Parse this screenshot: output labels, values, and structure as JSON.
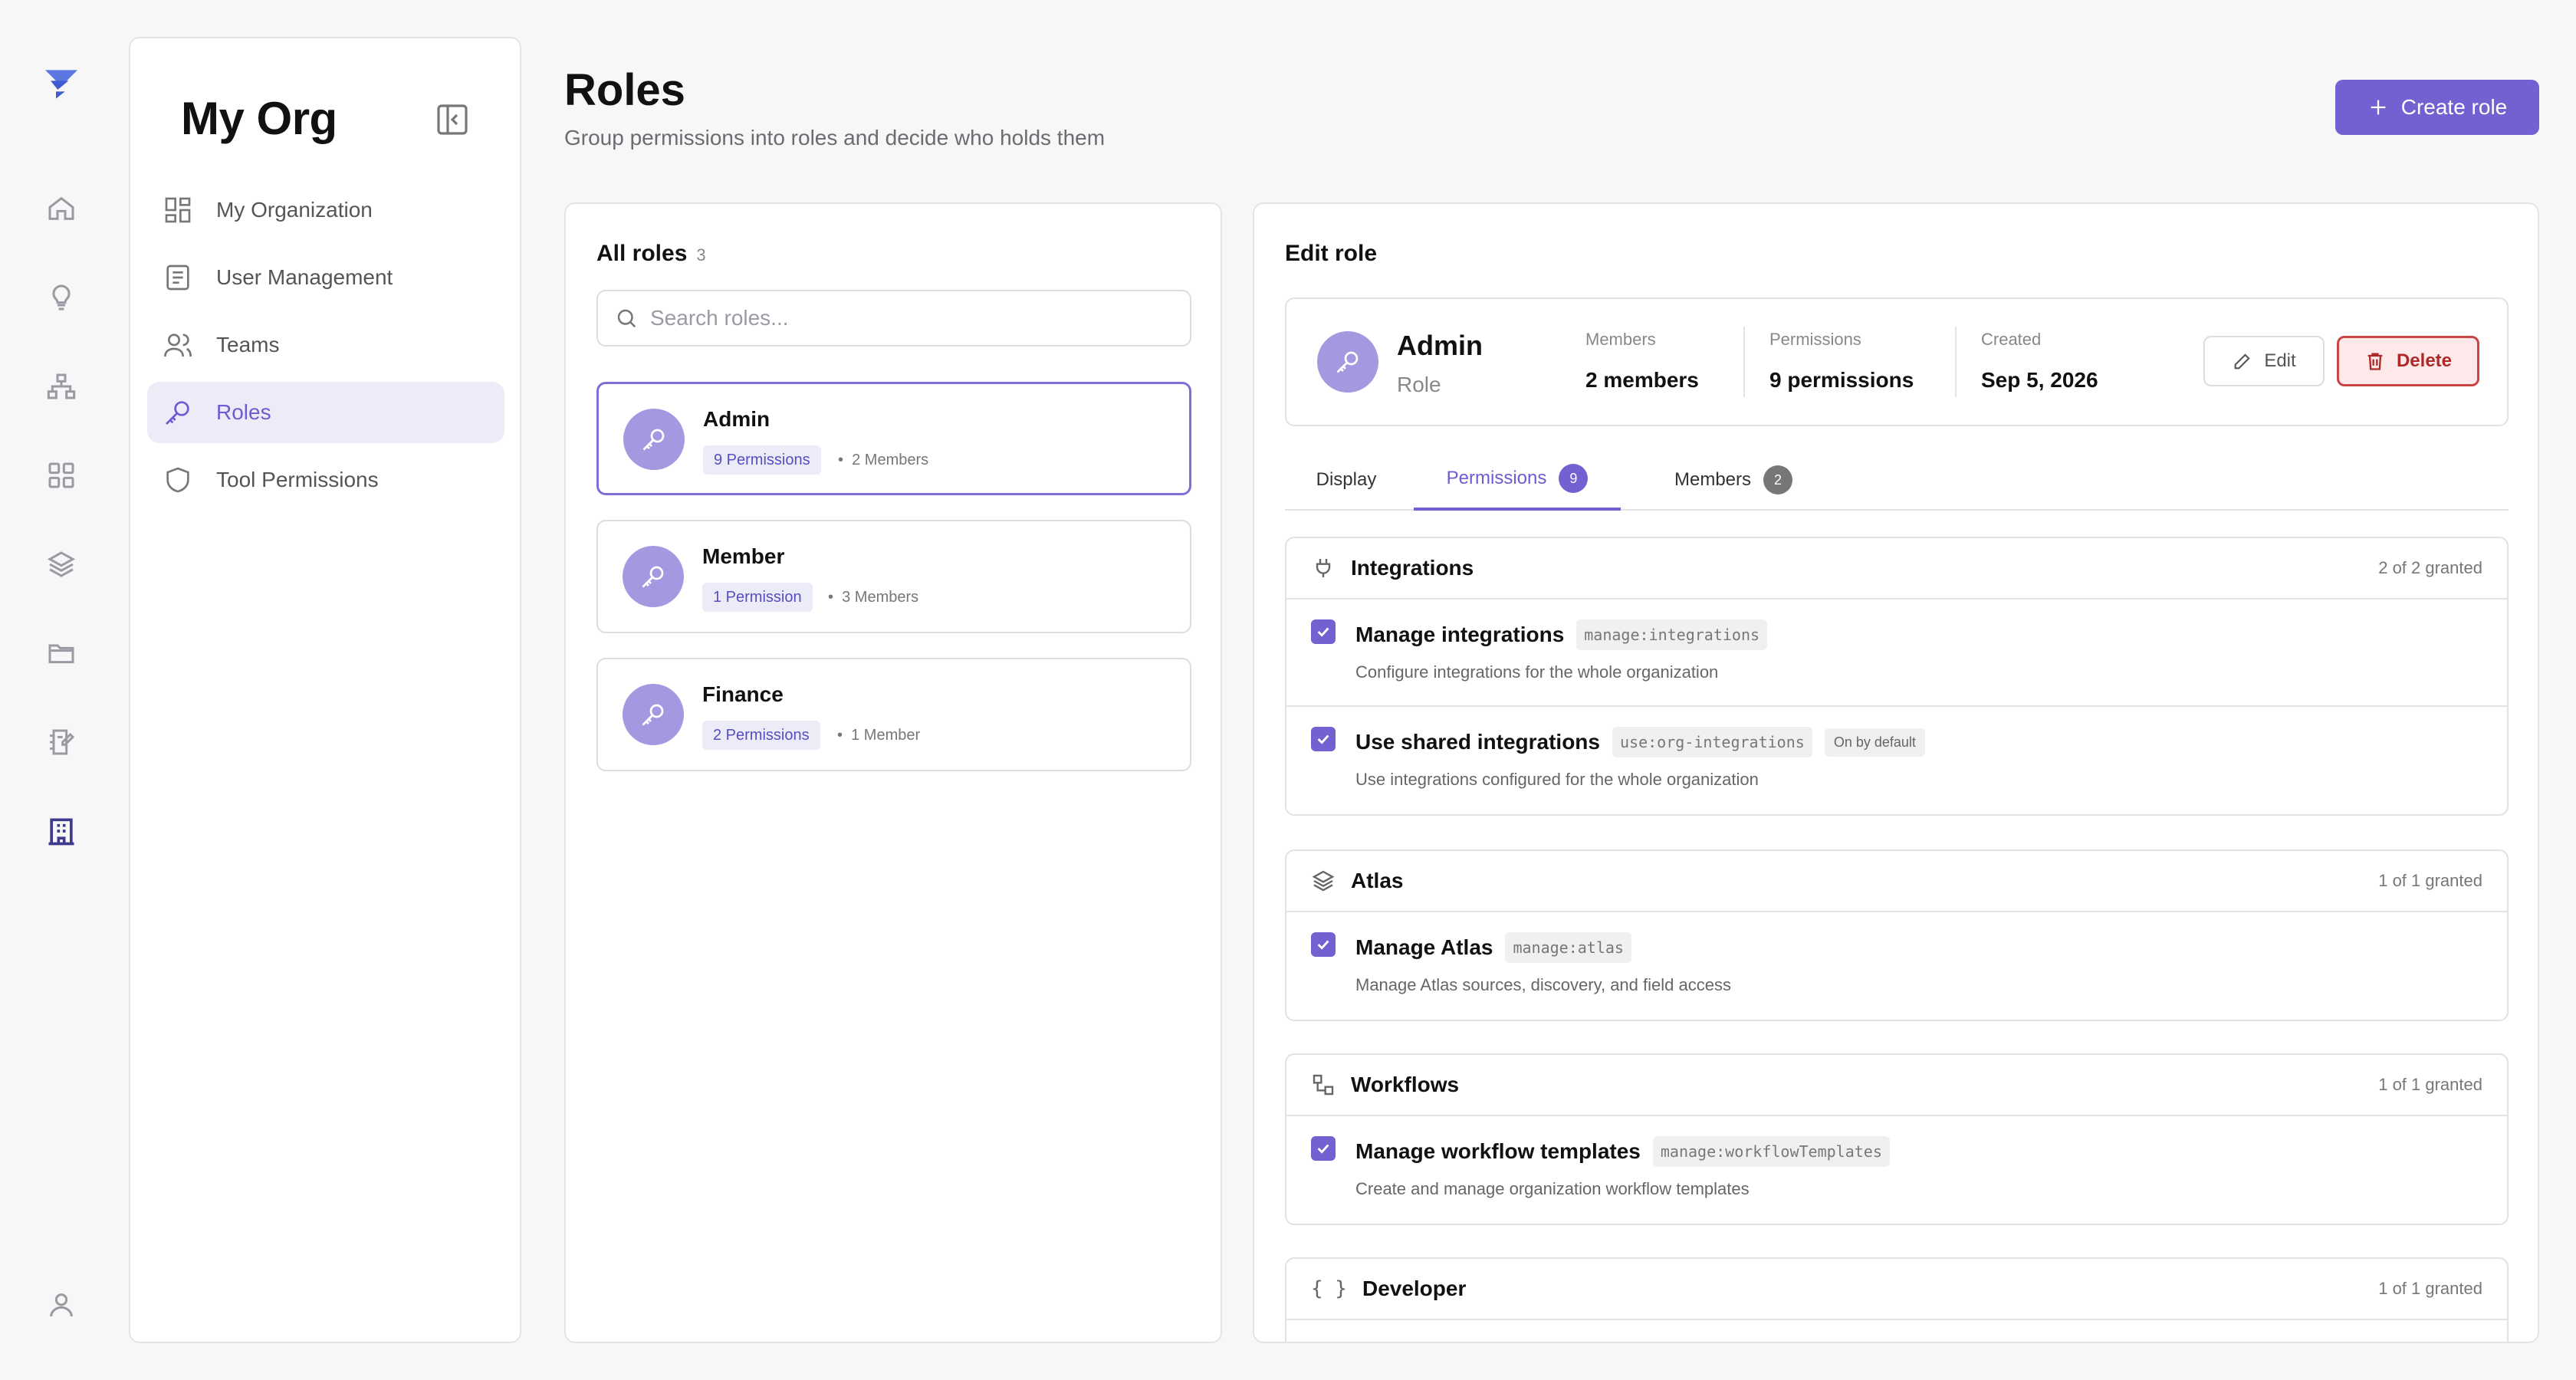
{
  "rail": {
    "icons": [
      "logo-icon",
      "home-icon",
      "lightbulb-icon",
      "hierarchy-icon",
      "grid-icon",
      "layers-icon",
      "folder-icon",
      "notebook-icon",
      "building-icon",
      "user-icon"
    ]
  },
  "sidebar": {
    "org_name": "My Org",
    "items": [
      {
        "label": "My Organization",
        "icon": "dashboard-icon"
      },
      {
        "label": "User Management",
        "icon": "list-icon"
      },
      {
        "label": "Teams",
        "icon": "users-icon"
      },
      {
        "label": "Roles",
        "icon": "key-icon",
        "active": true
      },
      {
        "label": "Tool Permissions",
        "icon": "shield-icon"
      }
    ]
  },
  "page": {
    "title": "Roles",
    "subtitle": "Group permissions into roles and decide who holds them",
    "create_label": "Create role"
  },
  "roles_panel": {
    "title": "All roles",
    "count": "3",
    "search_placeholder": "Search roles...",
    "roles": [
      {
        "name": "Admin",
        "permissions": "9 Permissions",
        "members": "2 Members",
        "selected": true
      },
      {
        "name": "Member",
        "permissions": "1 Permission",
        "members": "3 Members"
      },
      {
        "name": "Finance",
        "permissions": "2 Permissions",
        "members": "1 Member"
      }
    ]
  },
  "edit_panel": {
    "title": "Edit role",
    "role_name": "Admin",
    "role_type": "Role",
    "stats": [
      {
        "label": "Members",
        "value": "2 members"
      },
      {
        "label": "Permissions",
        "value": "9 permissions"
      },
      {
        "label": "Created",
        "value": "Sep 5, 2026"
      }
    ],
    "edit_label": "Edit",
    "delete_label": "Delete",
    "tabs": [
      {
        "label": "Display"
      },
      {
        "label": "Permissions",
        "badge": "9",
        "active": true
      },
      {
        "label": "Members",
        "badge": "2"
      }
    ],
    "groups": [
      {
        "name": "Integrations",
        "granted": "2 of 2 granted",
        "icon": "plug-icon",
        "items": [
          {
            "name": "Manage integrations",
            "code": "manage:integrations",
            "desc": "Configure integrations for the whole organization",
            "checked": true
          },
          {
            "name": "Use shared integrations",
            "code": "use:org-integrations",
            "tag": "On by default",
            "desc": "Use integrations configured for the whole organization",
            "checked": true
          }
        ]
      },
      {
        "name": "Atlas",
        "granted": "1 of 1 granted",
        "icon": "layers-icon",
        "items": [
          {
            "name": "Manage Atlas",
            "code": "manage:atlas",
            "desc": "Manage Atlas sources, discovery, and field access",
            "checked": true
          }
        ]
      },
      {
        "name": "Workflows",
        "granted": "1 of 1 granted",
        "icon": "workflow-icon",
        "items": [
          {
            "name": "Manage workflow templates",
            "code": "manage:workflowTemplates",
            "desc": "Create and manage organization workflow templates",
            "checked": true
          }
        ]
      },
      {
        "name": "Developer",
        "granted": "1 of 1 granted",
        "icon": "braces-icon",
        "items": []
      }
    ]
  },
  "colors": {
    "accent": "#7361d2",
    "accent_light": "#ecebf8",
    "danger": "#c94444",
    "background": "#f7f7f8"
  }
}
